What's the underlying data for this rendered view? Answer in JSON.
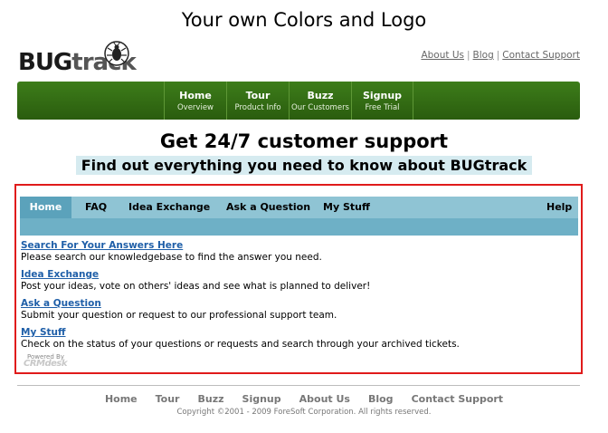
{
  "caption": "Your own Colors and Logo",
  "logo": {
    "bug": "BUG",
    "track": "track",
    "icon": "bug-icon"
  },
  "toplinks": [
    "About Us",
    "Blog",
    "Contact Support"
  ],
  "toplinks_separator": "|",
  "nav": [
    {
      "label": "Home",
      "sub": "Overview"
    },
    {
      "label": "Tour",
      "sub": "Product Info"
    },
    {
      "label": "Buzz",
      "sub": "Our Customers"
    },
    {
      "label": "Signup",
      "sub": "Free Trial"
    }
  ],
  "headline": "Get 24/7 customer support",
  "subhead": "Find out everything you need to know about BUGtrack",
  "tabs": [
    "Home",
    "FAQ",
    "Idea Exchange",
    "Ask a Question",
    "My Stuff",
    "Help"
  ],
  "entries": [
    {
      "link": "Search For Your Answers Here",
      "desc": "Please search our knowledgebase to find the answer you need."
    },
    {
      "link": "Idea Exchange",
      "desc": "Post your ideas, vote on others' ideas and see what is planned to deliver!"
    },
    {
      "link": "Ask a Question",
      "desc": "Submit your question or request to our professional support team."
    },
    {
      "link": "My Stuff",
      "desc": "Check on the status of your questions or requests and search through your archived tickets."
    }
  ],
  "powered": {
    "label": "Powered By",
    "brand": "CRMdesk"
  },
  "footer": {
    "links": [
      "Home",
      "Tour",
      "Buzz",
      "Signup",
      "About Us",
      "Blog",
      "Contact Support"
    ],
    "copyright": "Copyright ©2001 - 2009 ForeSoft Corporation. All rights reserved."
  },
  "colors": {
    "nav_green": "#2f6a12",
    "tab_blue": "#8fc4d4",
    "tab_active": "#5ba2bb",
    "frame_red": "#e01b1b",
    "link_blue": "#1f5fa8",
    "subhead_bg": "#d6ebf0"
  }
}
